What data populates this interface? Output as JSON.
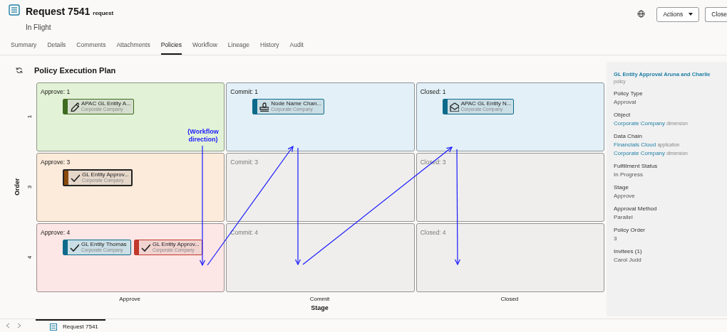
{
  "header": {
    "title": "Request 7541",
    "type": "request",
    "status": "In Flight",
    "buttons": [
      {
        "label": "Actions",
        "kind": "dropdown"
      },
      {
        "label": "Close",
        "kind": "plain"
      }
    ]
  },
  "tabs": [
    {
      "label": "Summary",
      "selected": false
    },
    {
      "label": "Details",
      "selected": false
    },
    {
      "label": "Comments",
      "selected": false
    },
    {
      "label": "Attachments",
      "selected": false
    },
    {
      "label": "Policies",
      "selected": true
    },
    {
      "label": "Workflow",
      "selected": false
    },
    {
      "label": "Lineage",
      "selected": false
    },
    {
      "label": "History",
      "selected": false
    },
    {
      "label": "Audit",
      "selected": false
    }
  ],
  "plan": {
    "title": "Policy Execution Plan",
    "lanes": [
      {
        "stages": [
          {
            "title": "Approve: 1",
            "color": "#e2f2d6",
            "chips": [
              {
                "title": "APAC GL Entity A...",
                "subtitle": "Corporate Company",
                "kind": "pencil",
                "color": "#3e6b1f",
                "selected": false
              }
            ]
          },
          {
            "title": "Commit: 1",
            "color": "#e3f0f7",
            "chips": [
              {
                "title": "Node Name Chan...",
                "subtitle": "Corporate Company",
                "kind": "stamp",
                "color": "#0e6a8a",
                "selected": false
              }
            ]
          },
          {
            "title": "Closed: 1",
            "color": "#e3f0f7",
            "chips": [
              {
                "title": "APAC GL Entity N...",
                "subtitle": "Corporate Company",
                "kind": "envelope",
                "color": "#0e6a8a",
                "selected": false
              }
            ]
          }
        ]
      },
      {
        "stages": [
          {
            "title": "Approve: 3",
            "color": "#fcebdb",
            "chips": [
              {
                "title": "GL Entity Approv...",
                "subtitle": "Corporate Company",
                "kind": "check",
                "color": "#8a4a0c",
                "selected": true
              }
            ]
          },
          {
            "title": "Commit: 3",
            "color": "#efeeec"
          },
          {
            "title": "Closed: 3",
            "color": "#efeeec"
          }
        ]
      },
      {
        "stages": [
          {
            "title": "Approve: 4",
            "color": "#fde7e6",
            "chips": [
              {
                "title": "GL Entity Thomas",
                "subtitle": "Corporate Company",
                "kind": "check",
                "color": "#0e6a8a",
                "selected": false
              },
              {
                "title": "GL Entity Approv...",
                "subtitle": "Corporate Company",
                "kind": "check",
                "color": "#c0392b",
                "selected": false
              }
            ]
          },
          {
            "title": "Commit: 4",
            "color": "#efeeec"
          },
          {
            "title": "Closed: 4",
            "color": "#efeeec"
          }
        ]
      }
    ],
    "ylabel": "Order",
    "order_ticks": [
      "1",
      "3",
      "4"
    ],
    "columns": [
      "Approve",
      "Commit",
      "Closed"
    ],
    "xlabel": "Stage"
  },
  "annotation": {
    "text": "(Workflow direction)"
  },
  "details": {
    "title": "GL Entity Approval Aruna and Charlie",
    "type": "policy",
    "fields": [
      {
        "label": "Policy Type",
        "values": [
          {
            "text": "Approval",
            "link": false
          }
        ]
      },
      {
        "label": "Object",
        "values": [
          {
            "text": "Corporate Company",
            "link": true,
            "suffix": "dimension"
          }
        ]
      },
      {
        "label": "Data Chain",
        "values": [
          {
            "text": "Financials Cloud",
            "link": true,
            "suffix": "application"
          },
          {
            "text": "Corporate Company",
            "link": true,
            "suffix": "dimension"
          }
        ]
      },
      {
        "label": "Fulfillment Status",
        "values": [
          {
            "text": "In Progress",
            "link": false
          }
        ]
      },
      {
        "label": "Stage",
        "values": [
          {
            "text": "Approve",
            "link": false
          }
        ]
      },
      {
        "label": "Approval Method",
        "values": [
          {
            "text": "Parallel",
            "link": false
          }
        ]
      },
      {
        "label": "Policy Order",
        "values": [
          {
            "text": "3",
            "link": false
          }
        ]
      },
      {
        "label": "Invitees (1)",
        "values": [
          {
            "text": "Carol Judd",
            "link": false
          }
        ]
      }
    ]
  },
  "footer": {
    "tab": "Request 7541"
  }
}
